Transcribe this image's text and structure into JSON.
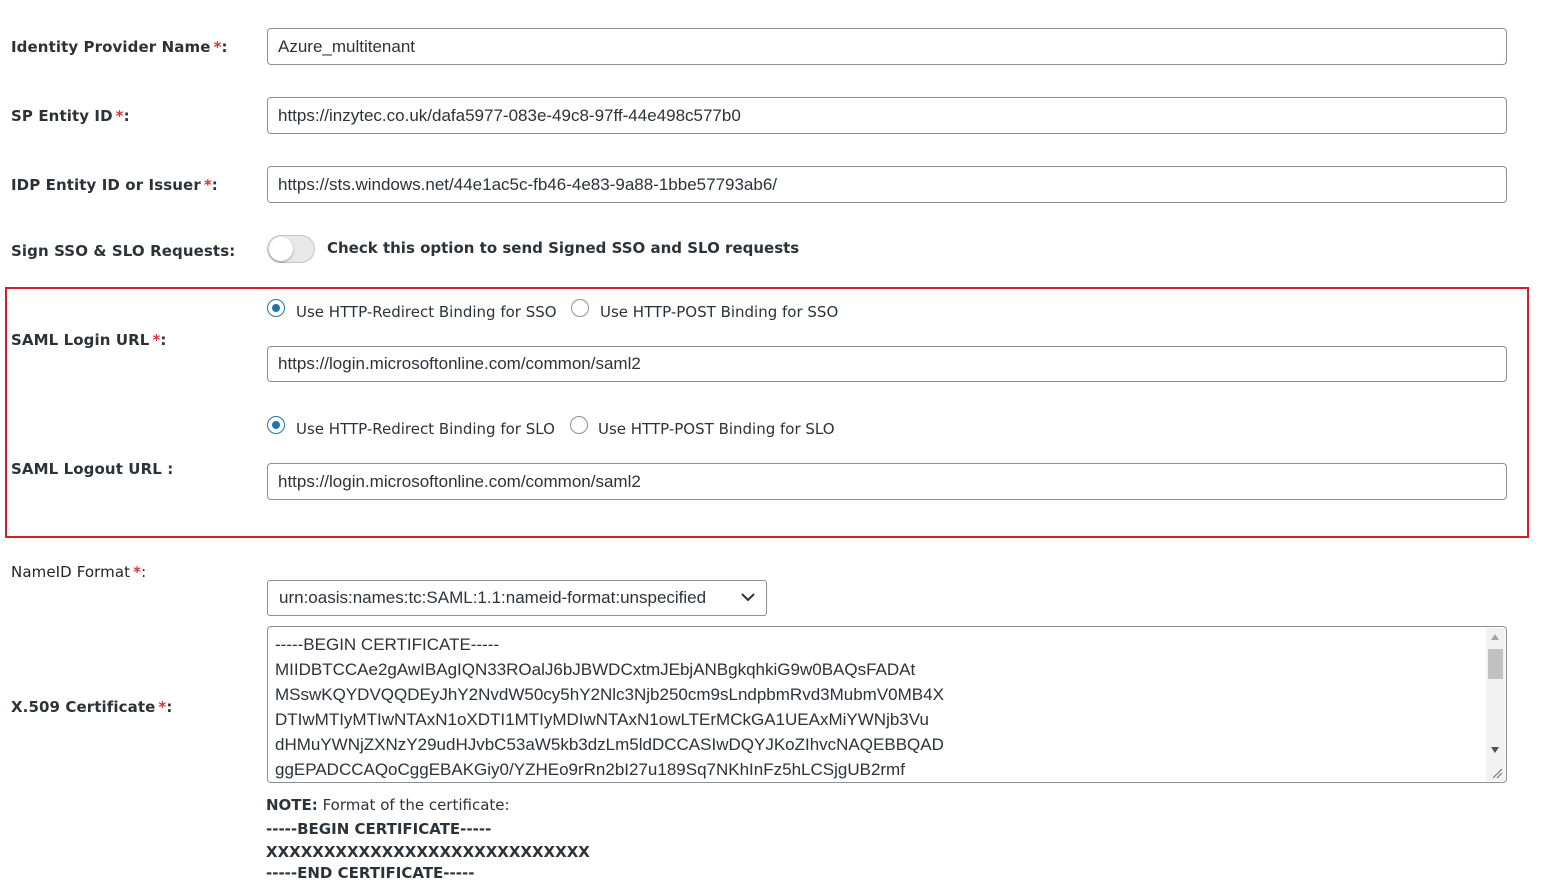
{
  "form": {
    "identity_provider_name": {
      "label": "Identity Provider Name",
      "required_mark": "*",
      "suffix": ":",
      "value": "Azure_multitenant"
    },
    "sp_entity_id": {
      "label": "SP Entity ID",
      "required_mark": "*",
      "suffix": ":",
      "value": "https://inzytec.co.uk/dafa5977-083e-49c8-97ff-44e498c577b0"
    },
    "idp_entity_id": {
      "label": "IDP Entity ID or Issuer",
      "required_mark": "*",
      "suffix": ":",
      "value": "https://sts.windows.net/44e1ac5c-fb46-4e83-9a88-1bbe57793ab6/"
    },
    "sign_requests": {
      "label": "Sign SSO & SLO Requests:",
      "toggle_text": "Check this option to send Signed SSO and SLO requests",
      "enabled": false
    },
    "saml_login": {
      "label": "SAML Login URL",
      "required_mark": "*",
      "suffix": ":",
      "option_redirect": "Use HTTP-Redirect Binding for SSO",
      "option_post": "Use HTTP-POST Binding for SSO",
      "selected": "redirect",
      "value": "https://login.microsoftonline.com/common/saml2"
    },
    "saml_logout": {
      "label": "SAML Logout URL :",
      "option_redirect": "Use HTTP-Redirect Binding for SLO",
      "option_post": "Use HTTP-POST Binding for SLO",
      "selected": "redirect",
      "value": "https://login.microsoftonline.com/common/saml2"
    },
    "nameid_format": {
      "label": "NameID Format",
      "required_mark": "*",
      "suffix": ":",
      "selected": "urn:oasis:names:tc:SAML:1.1:nameid-format:unspecified"
    },
    "certificate": {
      "label": "X.509 Certificate",
      "required_mark": "*",
      "suffix": ":",
      "lines": [
        "-----BEGIN CERTIFICATE-----",
        "MIIDBTCCAe2gAwIBAgIQN33ROalJ6bJBWDCxtmJEbjANBgkqhkiG9w0BAQsFADAt",
        "MSswKQYDVQQDEyJhY2NvdW50cy5hY2Nlc3Njb250cm9sLndpbmRvd3MubmV0MB4X",
        "DTIwMTIyMTIwNTAxN1oXDTI1MTIyMDIwNTAxN1owLTErMCkGA1UEAxMiYWNjb3Vu",
        "dHMuYWNjZXNzY29udHJvbC53aW5kb3dzLm5ldDCCASIwDQYJKoZIhvcNAQEBBQAD",
        "ggEPADCCAQoCggEBAKGiy0/YZHEo9rRn2bI27u189Sq7NKhInFz5hLCSjgUB2rmf"
      ]
    },
    "note": {
      "prefix": "NOTE:",
      "text": "Format of the certificate:",
      "line_begin": "-----BEGIN CERTIFICATE-----",
      "line_body": "XXXXXXXXXXXXXXXXXXXXXXXXXXXX",
      "line_end": "-----END CERTIFICATE-----"
    }
  },
  "colors": {
    "required": "#d63638",
    "highlight_border": "#d0202e",
    "radio_checked": "#2271b1"
  },
  "icons": {
    "select_chevron": "chevron-down-icon",
    "resize_handle": "resize-grip-icon"
  }
}
